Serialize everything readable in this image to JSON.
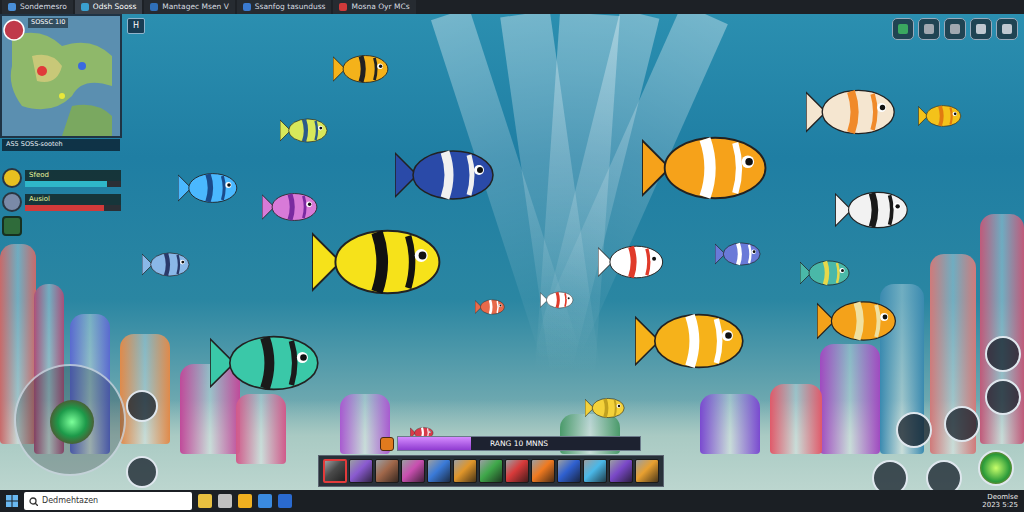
{
  "window": {
    "tabs": [
      {
        "label": "Sondemesro",
        "selected": false
      },
      {
        "label": "Odsh Sooss",
        "selected": true
      },
      {
        "label": "Mantagec Msen V",
        "selected": false
      },
      {
        "label": "Ssanfog tasunduss",
        "selected": false
      },
      {
        "label": "Mosna Oyr MCs",
        "selected": false
      }
    ]
  },
  "minimap": {
    "title": "SOSSC 1I0",
    "caption": "AS5  SOSS-sooteh",
    "button": "H"
  },
  "stats": [
    {
      "label": "Sfeod",
      "level": 0.85,
      "color": "#2fb7c9"
    },
    {
      "label": "Ausiol",
      "level": 0.82,
      "color": "#d23a3a"
    }
  ],
  "progress": {
    "label": "RANG 10 MNNS",
    "level": 0.3
  },
  "skills": [
    {
      "color": "#4a4a4a",
      "selected": true
    },
    {
      "color": "#8a5ad0",
      "selected": false
    },
    {
      "color": "#a0674a",
      "selected": false
    },
    {
      "color": "#c94fb0",
      "selected": false
    },
    {
      "color": "#3a7ad8",
      "selected": false
    },
    {
      "color": "#e0962a",
      "selected": false
    },
    {
      "color": "#3fa84a",
      "selected": false
    },
    {
      "color": "#d83a3a",
      "selected": false
    },
    {
      "color": "#f07a20",
      "selected": false
    },
    {
      "color": "#2f60d0",
      "selected": false
    },
    {
      "color": "#4ab8e8",
      "selected": false
    },
    {
      "color": "#7a48c8",
      "selected": false
    },
    {
      "color": "#e8a030",
      "selected": false
    }
  ],
  "taskbar": {
    "search": "Dedmehtazen",
    "clock": [
      "Deomlse",
      "2023 5:25"
    ]
  }
}
